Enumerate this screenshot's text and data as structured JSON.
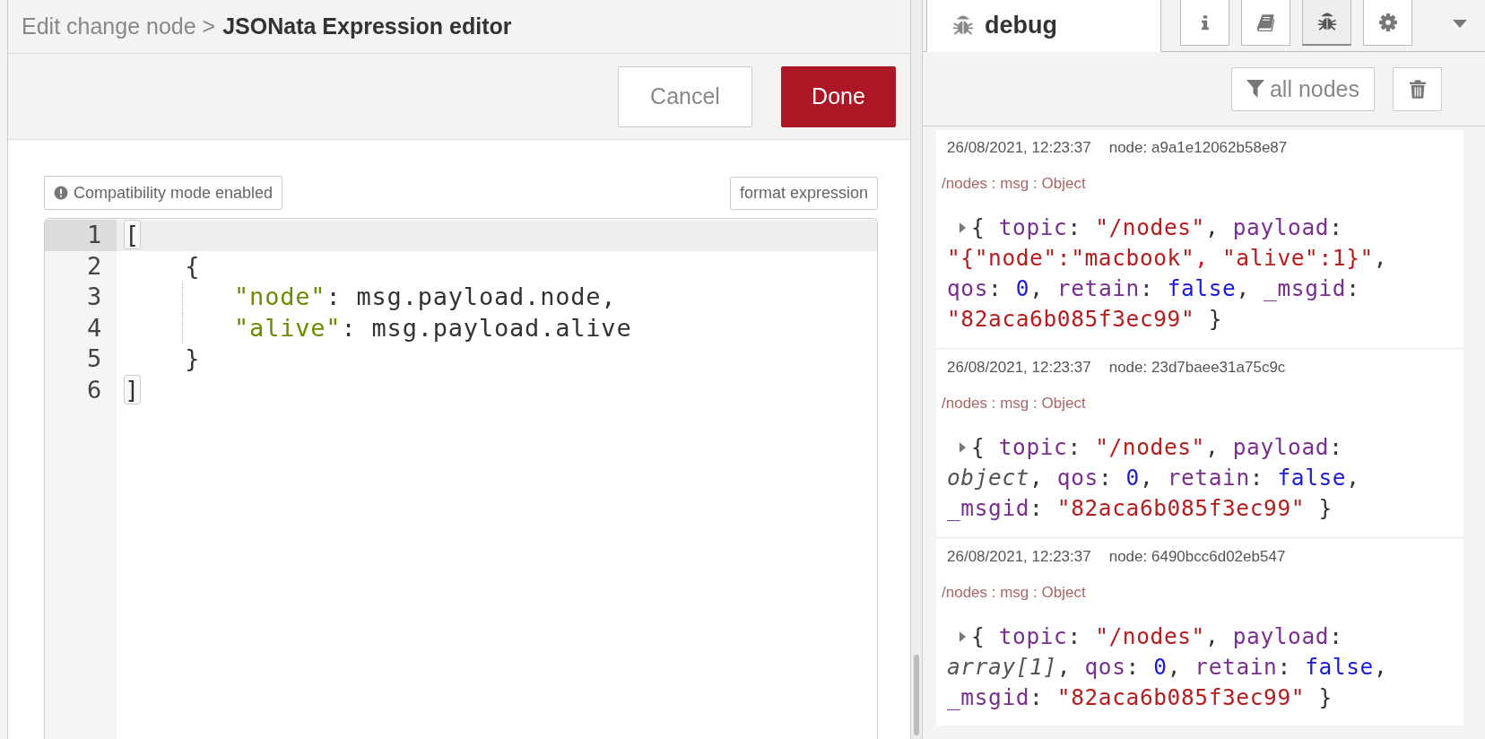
{
  "breadcrumb": {
    "parent": "Edit change node >",
    "title": "JSONata Expression editor"
  },
  "toolbar": {
    "buttons": [
      {
        "label": "Cancel",
        "kind": "secondary"
      },
      {
        "label": "Done",
        "kind": "primary"
      }
    ]
  },
  "editor": {
    "compatibility": "Compatibility mode enabled",
    "format_button": "format expression",
    "lines": [
      {
        "number": "1",
        "active": true,
        "tokens": [
          {
            "kind": "bracket",
            "text": "["
          }
        ]
      },
      {
        "number": "2",
        "active": false,
        "tokens": [
          {
            "kind": "plain",
            "text": "    {"
          }
        ]
      },
      {
        "number": "3",
        "active": false,
        "guide": true,
        "tokens": [
          {
            "kind": "key",
            "text": "\"node\""
          },
          {
            "kind": "plain",
            "text": ": msg.payload.node,"
          }
        ]
      },
      {
        "number": "4",
        "active": false,
        "guide": true,
        "tokens": [
          {
            "kind": "key",
            "text": "\"alive\""
          },
          {
            "kind": "plain",
            "text": ": msg.payload.alive"
          }
        ]
      },
      {
        "number": "5",
        "active": false,
        "tokens": [
          {
            "kind": "plain",
            "text": "    }"
          }
        ]
      },
      {
        "number": "6",
        "active": false,
        "tokens": [
          {
            "kind": "bracket",
            "text": "]"
          }
        ]
      }
    ]
  },
  "sidebar": {
    "title": "debug",
    "tabs": [
      {
        "kind": "info",
        "selected": false
      },
      {
        "kind": "book",
        "selected": false
      },
      {
        "kind": "bug",
        "selected": true
      },
      {
        "kind": "gear",
        "selected": false
      }
    ],
    "filter_button": "all nodes",
    "messages": [
      {
        "time": "26/08/2021, 12:23:37",
        "node": "node: a9a1e12062b58e87",
        "topic": "/nodes : msg : Object",
        "lines": [
          [
            {
              "kind": "punct",
              "text": "{ "
            },
            {
              "kind": "prop",
              "text": "topic"
            },
            {
              "kind": "punct",
              "text": ": "
            },
            {
              "kind": "string",
              "text": "\"/nodes\""
            },
            {
              "kind": "punct",
              "text": ", "
            },
            {
              "kind": "prop",
              "text": "payload"
            },
            {
              "kind": "punct",
              "text": ":"
            }
          ],
          [
            {
              "kind": "string",
              "text": "\"{\"node\":\"macbook\", \"alive\":1}\""
            },
            {
              "kind": "punct",
              "text": ","
            }
          ],
          [
            {
              "kind": "prop",
              "text": "qos"
            },
            {
              "kind": "punct",
              "text": ": "
            },
            {
              "kind": "number",
              "text": "0"
            },
            {
              "kind": "punct",
              "text": ", "
            },
            {
              "kind": "prop",
              "text": "retain"
            },
            {
              "kind": "punct",
              "text": ": "
            },
            {
              "kind": "number",
              "text": "false"
            },
            {
              "kind": "punct",
              "text": ", "
            },
            {
              "kind": "prop",
              "text": "_msgid"
            },
            {
              "kind": "punct",
              "text": ":"
            }
          ],
          [
            {
              "kind": "string",
              "text": "\"82aca6b085f3ec99\""
            },
            {
              "kind": "punct",
              "text": " }"
            }
          ]
        ]
      },
      {
        "time": "26/08/2021, 12:23:37",
        "node": "node: 23d7baee31a75c9c",
        "topic": "/nodes : msg : Object",
        "lines": [
          [
            {
              "kind": "punct",
              "text": "{ "
            },
            {
              "kind": "prop",
              "text": "topic"
            },
            {
              "kind": "punct",
              "text": ": "
            },
            {
              "kind": "string",
              "text": "\"/nodes\""
            },
            {
              "kind": "punct",
              "text": ", "
            },
            {
              "kind": "prop",
              "text": "payload"
            },
            {
              "kind": "punct",
              "text": ":"
            }
          ],
          [
            {
              "kind": "type",
              "text": "object"
            },
            {
              "kind": "punct",
              "text": ", "
            },
            {
              "kind": "prop",
              "text": "qos"
            },
            {
              "kind": "punct",
              "text": ": "
            },
            {
              "kind": "number",
              "text": "0"
            },
            {
              "kind": "punct",
              "text": ", "
            },
            {
              "kind": "prop",
              "text": "retain"
            },
            {
              "kind": "punct",
              "text": ": "
            },
            {
              "kind": "number",
              "text": "false"
            },
            {
              "kind": "punct",
              "text": ","
            }
          ],
          [
            {
              "kind": "prop",
              "text": "_msgid"
            },
            {
              "kind": "punct",
              "text": ": "
            },
            {
              "kind": "string",
              "text": "\"82aca6b085f3ec99\""
            },
            {
              "kind": "punct",
              "text": " }"
            }
          ]
        ]
      },
      {
        "time": "26/08/2021, 12:23:37",
        "node": "node: 6490bcc6d02eb547",
        "topic": "/nodes : msg : Object",
        "lines": [
          [
            {
              "kind": "punct",
              "text": "{ "
            },
            {
              "kind": "prop",
              "text": "topic"
            },
            {
              "kind": "punct",
              "text": ": "
            },
            {
              "kind": "string",
              "text": "\"/nodes\""
            },
            {
              "kind": "punct",
              "text": ", "
            },
            {
              "kind": "prop",
              "text": "payload"
            },
            {
              "kind": "punct",
              "text": ":"
            }
          ],
          [
            {
              "kind": "type",
              "text": "array[1]"
            },
            {
              "kind": "punct",
              "text": ", "
            },
            {
              "kind": "prop",
              "text": "qos"
            },
            {
              "kind": "punct",
              "text": ": "
            },
            {
              "kind": "number",
              "text": "0"
            },
            {
              "kind": "punct",
              "text": ", "
            },
            {
              "kind": "prop",
              "text": "retain"
            },
            {
              "kind": "punct",
              "text": ": "
            },
            {
              "kind": "number",
              "text": "false"
            },
            {
              "kind": "punct",
              "text": ","
            }
          ],
          [
            {
              "kind": "prop",
              "text": "_msgid"
            },
            {
              "kind": "punct",
              "text": ": "
            },
            {
              "kind": "string",
              "text": "\"82aca6b085f3ec99\""
            },
            {
              "kind": "punct",
              "text": " }"
            }
          ]
        ]
      }
    ]
  }
}
